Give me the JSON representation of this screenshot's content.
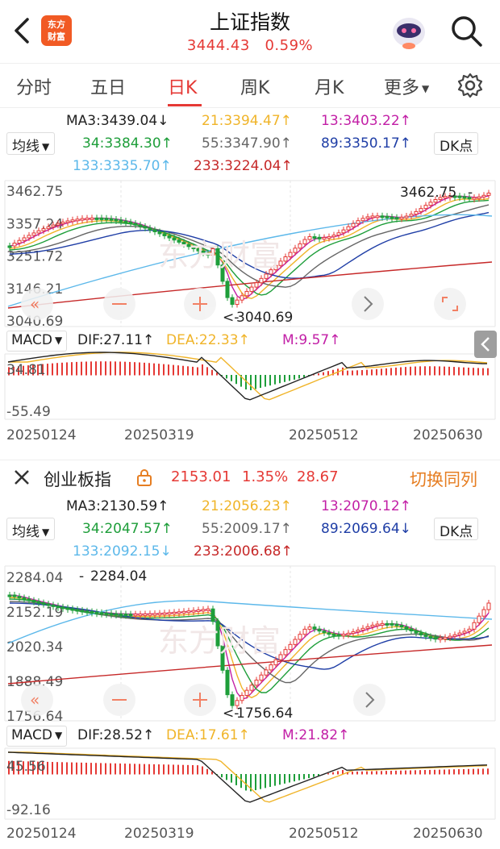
{
  "header": {
    "title": "上证指数",
    "price": "3444.43",
    "change_pct": "0.59%",
    "logo_line1": "东方",
    "logo_line2": "财富"
  },
  "tabs": [
    {
      "label": "分时"
    },
    {
      "label": "五日"
    },
    {
      "label": "日K"
    },
    {
      "label": "周K"
    },
    {
      "label": "月K"
    },
    {
      "label": "更多"
    }
  ],
  "colors": {
    "up": "#e53935",
    "down": "#1e9e3a",
    "ma21": "#f0b429",
    "ma13": "#c21fa6",
    "ma34": "#1e9e3a",
    "ma55": "#666666",
    "ma89": "#1f3ea6",
    "ma133": "#5cb8ea",
    "ma233": "#c62828"
  },
  "chart1": {
    "selector": "均线",
    "dk_button": "DK点",
    "ma": {
      "ma3": "MA3:3439.04↓",
      "ma21": "21:3394.47↑",
      "ma13": "13:3403.22↑",
      "ma34": "34:3384.30↑",
      "ma55": "55:3347.90↑",
      "ma89": "89:3350.17↑",
      "ma133": "133:3335.70↑",
      "ma233": "233:3224.04↑"
    },
    "yticks": [
      "3462.75",
      "3357.24",
      "3251.72",
      "3146.21",
      "3040.69"
    ],
    "high_label": "3462.75",
    "low_label": "3040.69",
    "macd_selector": "MACD",
    "dif": "DIF:27.11↑",
    "dea": "DEA:22.33↑",
    "m": "M:9.57↑",
    "macd_top": "34.81",
    "macd_bottom": "-55.49",
    "dates": [
      "20250124",
      "20250319",
      "20250512",
      "20250630"
    ]
  },
  "panel2": {
    "name": "创业板指",
    "price": "2153.01",
    "pct": "1.35%",
    "change": "28.67",
    "switch": "切换同列"
  },
  "chart2": {
    "selector": "均线",
    "dk_button": "DK点",
    "ma": {
      "ma3": "MA3:2130.59↑",
      "ma21": "21:2056.23↑",
      "ma13": "13:2070.12↑",
      "ma34": "34:2047.57↑",
      "ma55": "55:2009.17↑",
      "ma89": "89:2069.64↓",
      "ma133": "133:2092.15↓",
      "ma233": "233:2006.68↑"
    },
    "yticks": [
      "2284.04",
      "2152.19",
      "2020.34",
      "1888.49",
      "1756.64"
    ],
    "high_label": "2284.04",
    "low_label": "1756.64",
    "macd_selector": "MACD",
    "dif": "DIF:28.52↑",
    "dea": "DEA:17.61↑",
    "m": "M:21.82↑",
    "macd_top": "45.56",
    "macd_bottom": "-92.16",
    "dates": [
      "20250124",
      "20250319",
      "20250512",
      "20250630"
    ]
  }
}
